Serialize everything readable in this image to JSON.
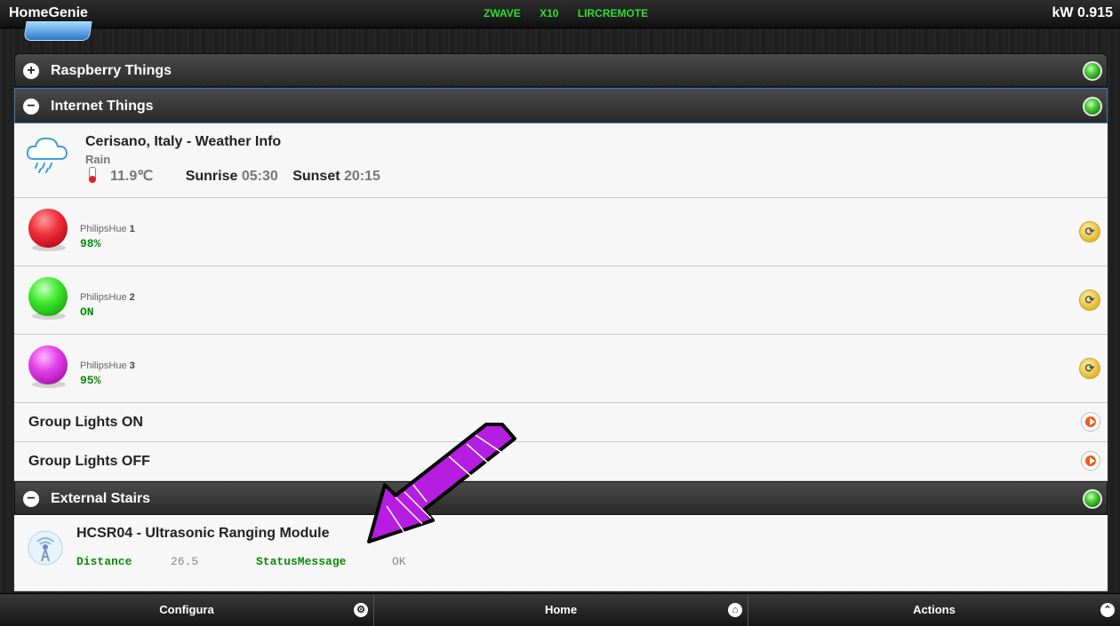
{
  "header": {
    "title": "HomeGenie",
    "interfaces": [
      "ZWAVE",
      "X10",
      "LIRCREMOTE"
    ],
    "power": "kW 0.915"
  },
  "groups": {
    "raspberry": {
      "label": "Raspberry Things",
      "toggle": "+"
    },
    "internet": {
      "label": "Internet Things",
      "toggle": "−"
    },
    "stairs": {
      "label": "External Stairs",
      "toggle": "−"
    }
  },
  "weather": {
    "title": "Cerisano, Italy - Weather Info",
    "condition": "Rain",
    "temperature": "11.9℃",
    "sunrise_label": "Sunrise",
    "sunrise": "05:30",
    "sunset_label": "Sunset",
    "sunset": "20:15"
  },
  "lights": [
    {
      "name": "PhilipsHue",
      "num": "1",
      "level": "98%",
      "color": "#e8303a"
    },
    {
      "name": "PhilipsHue",
      "num": "2",
      "level": "ON",
      "color": "#3ee82e"
    },
    {
      "name": "PhilipsHue",
      "num": "3",
      "level": "95%",
      "color": "#e23ee8"
    }
  ],
  "scenes": [
    {
      "label": "Group Lights ON"
    },
    {
      "label": "Group Lights OFF"
    }
  ],
  "sensor": {
    "title": "HCSR04 - Ultrasonic Ranging Module",
    "distance_label": "Distance",
    "distance": "26.5",
    "status_label": "StatusMessage",
    "status": "OK"
  },
  "bottom": {
    "configure": "Configura",
    "home": "Home",
    "actions": "Actions"
  },
  "icons": {
    "configure": "gear-icon",
    "home": "home-icon",
    "actions": "chevron-up-icon"
  }
}
